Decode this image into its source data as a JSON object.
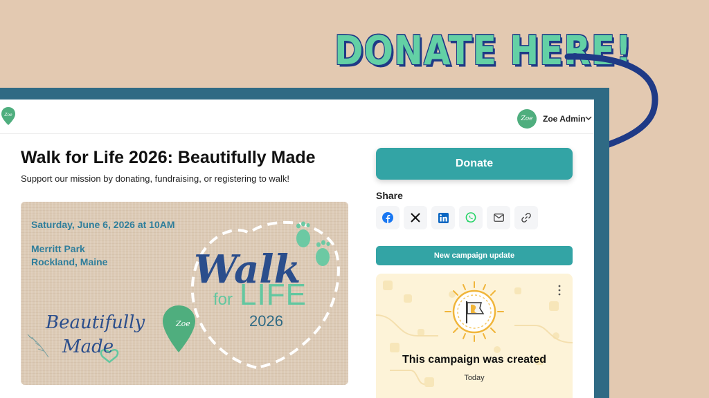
{
  "promo": {
    "headline": "DONATE HERE!"
  },
  "topbar": {
    "logo": "Zoe",
    "user": {
      "avatar_text": "Zoe",
      "name": "Zoe Admin",
      "chevron_icon": "chevron-down-icon"
    }
  },
  "campaign": {
    "title": "Walk for Life 2026: Beautifully Made",
    "subtitle": "Support our mission by donating, fundraising, or registering to walk!"
  },
  "banner": {
    "date": "Saturday, June 6, 2026 at 10AM",
    "location_line1": "Merritt Park",
    "location_line2": "Rockland, Maine",
    "walk": "Walk",
    "for": "for",
    "life": "LIFE",
    "year": "2026",
    "beautifully": "Beautifully",
    "made": "Made",
    "pin_text": "Zoe"
  },
  "sidebar": {
    "donate_label": "Donate",
    "share_label": "Share",
    "share_icons": [
      "facebook-icon",
      "x-icon",
      "linkedin-icon",
      "whatsapp-icon",
      "email-icon",
      "link-icon"
    ],
    "update_label": "New campaign update",
    "activity": {
      "title": "This campaign was created",
      "time": "Today"
    }
  },
  "colors": {
    "background": "#e3c9b1",
    "frame": "#2f6a84",
    "accent": "#33a4a5",
    "headline_fill": "#63d0a5",
    "headline_outline": "#1f3a86",
    "brand_green": "#4fae7e"
  }
}
